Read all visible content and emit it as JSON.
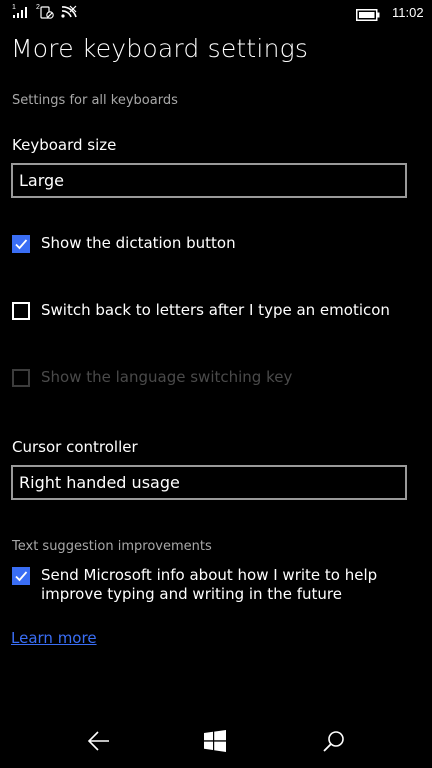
{
  "status_bar": {
    "sim1_label": "1",
    "sim2_label": "2",
    "time": "11:02"
  },
  "title": "More keyboard settings",
  "sections": {
    "all_keyboards_header": "Settings for all keyboards",
    "keyboard_size": {
      "label": "Keyboard size",
      "value": "Large"
    },
    "dictation": {
      "label": "Show the dictation button",
      "checked": true
    },
    "switch_back": {
      "label": "Switch back to letters after I type an emoticon",
      "checked": false
    },
    "language_key": {
      "label": "Show the language switching key",
      "checked": false,
      "disabled": true
    },
    "cursor_controller": {
      "label": "Cursor controller",
      "value": "Right handed usage"
    },
    "text_suggestion_header": "Text suggestion improvements",
    "send_info": {
      "label": "Send Microsoft info about how I write to help improve typing and writing in the future",
      "checked": true
    },
    "learn_more": "Learn more"
  },
  "nav_bar": {
    "back": "back-arrow-icon",
    "home": "windows-logo-icon",
    "search": "search-icon"
  },
  "colors": {
    "accent": "#3a6ef5",
    "background": "#000000",
    "border": "#9a9a9a",
    "secondary_text": "#a8a8a8",
    "disabled": "#4a4a4a"
  }
}
